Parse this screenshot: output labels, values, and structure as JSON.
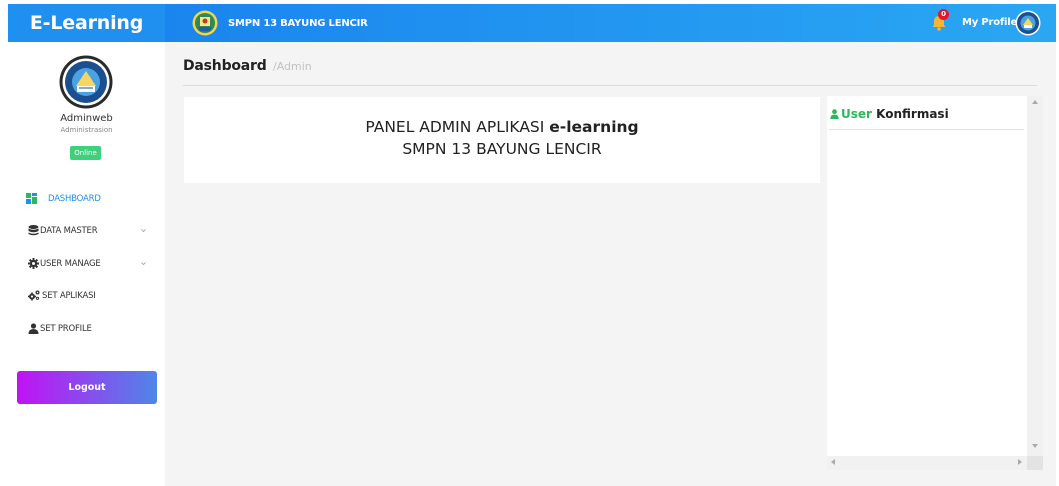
{
  "brand": {
    "title": "E-Learning"
  },
  "header": {
    "school_name": "SMPN 13 BAYUNG LENCIR",
    "notification_count": "0",
    "profile_label": "My Profile"
  },
  "sidebar": {
    "user_name": "Adminweb",
    "user_role": "Administrasion",
    "status": "Online",
    "items": [
      {
        "label": "DASHBOARD",
        "icon": "dashboard-icon"
      },
      {
        "label": "DATA MASTER",
        "icon": "database-icon"
      },
      {
        "label": "USER MANAGE",
        "icon": "gear-icon"
      },
      {
        "label": "SET APLIKASI",
        "icon": "cogs-icon"
      },
      {
        "label": "SET PROFILE",
        "icon": "user-icon"
      }
    ],
    "logout_label": "Logout"
  },
  "main": {
    "title": "Dashboard",
    "subtitle": "/Admin",
    "panel": {
      "line1_prefix": "PANEL ADMIN APLIKASI",
      "line1_bold": "e-learning",
      "line2": "SMPN 13 BAYUNG LENCIR"
    },
    "side_panel": {
      "title_green": "User",
      "title_rest": "Konfirmasi"
    }
  },
  "colors": {
    "primary": "#1f8ff0",
    "online": "#3ed07a",
    "logout_start": "#c112f4",
    "logout_end": "#4f86e8",
    "badge": "#e6152d",
    "accent_green": "#2db95b"
  }
}
